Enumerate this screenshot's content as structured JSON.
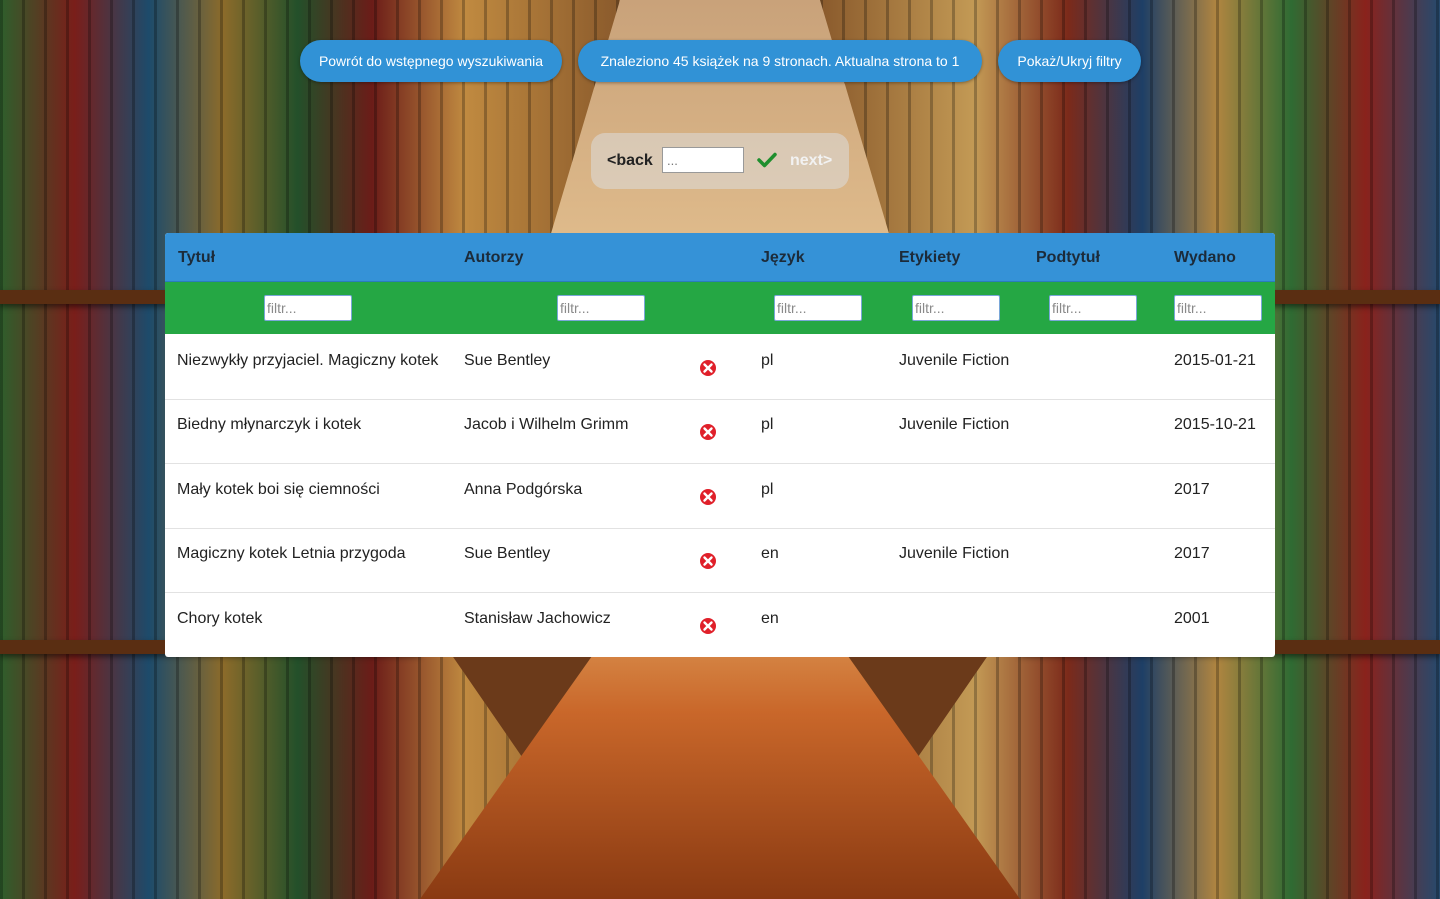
{
  "topbar": {
    "back_search_label": "Powrót do wstępnego wyszukiwania",
    "results_info": "Znaleziono 45 książek na 9 stronach. Aktualna strona to 1",
    "toggle_filters_label": "Pokaż/Ukryj filtry"
  },
  "pager": {
    "back_label": "<back",
    "next_label": "next>",
    "page_input_placeholder": "...",
    "confirm_icon": "checkmark-icon"
  },
  "table": {
    "headers": [
      "Tytuł",
      "Autorzy",
      "Język",
      "Etykiety",
      "Podtytuł",
      "Wydano"
    ],
    "filter_placeholder": "filtr...",
    "delete_icon": "remove-x-circle-icon",
    "rows": [
      {
        "title": "Niezwykły przyjaciel. Magiczny kotek",
        "authors": "Sue Bentley",
        "language": "pl",
        "tags": "Juvenile Fiction",
        "subtitle": "",
        "published": "2015-01-21"
      },
      {
        "title": "Biedny młynarczyk i kotek",
        "authors": "Jacob i Wilhelm Grimm",
        "language": "pl",
        "tags": "Juvenile Fiction",
        "subtitle": "",
        "published": "2015-10-21"
      },
      {
        "title": "Mały kotek boi się ciemności",
        "authors": "Anna Podgórska",
        "language": "pl",
        "tags": "",
        "subtitle": "",
        "published": "2017"
      },
      {
        "title": "Magiczny kotek Letnia przygoda",
        "authors": "Sue Bentley",
        "language": "en",
        "tags": "Juvenile Fiction",
        "subtitle": "",
        "published": "2017"
      },
      {
        "title": "Chory kotek",
        "authors": "Stanisław Jachowicz",
        "language": "en",
        "tags": "",
        "subtitle": "",
        "published": "2001"
      }
    ]
  },
  "colors": {
    "header_blue": "#3592d7",
    "filter_green": "#25a744",
    "button_blue": "#3192d6",
    "delete_red": "#e0202a",
    "check_green": "#1f8f2e"
  }
}
